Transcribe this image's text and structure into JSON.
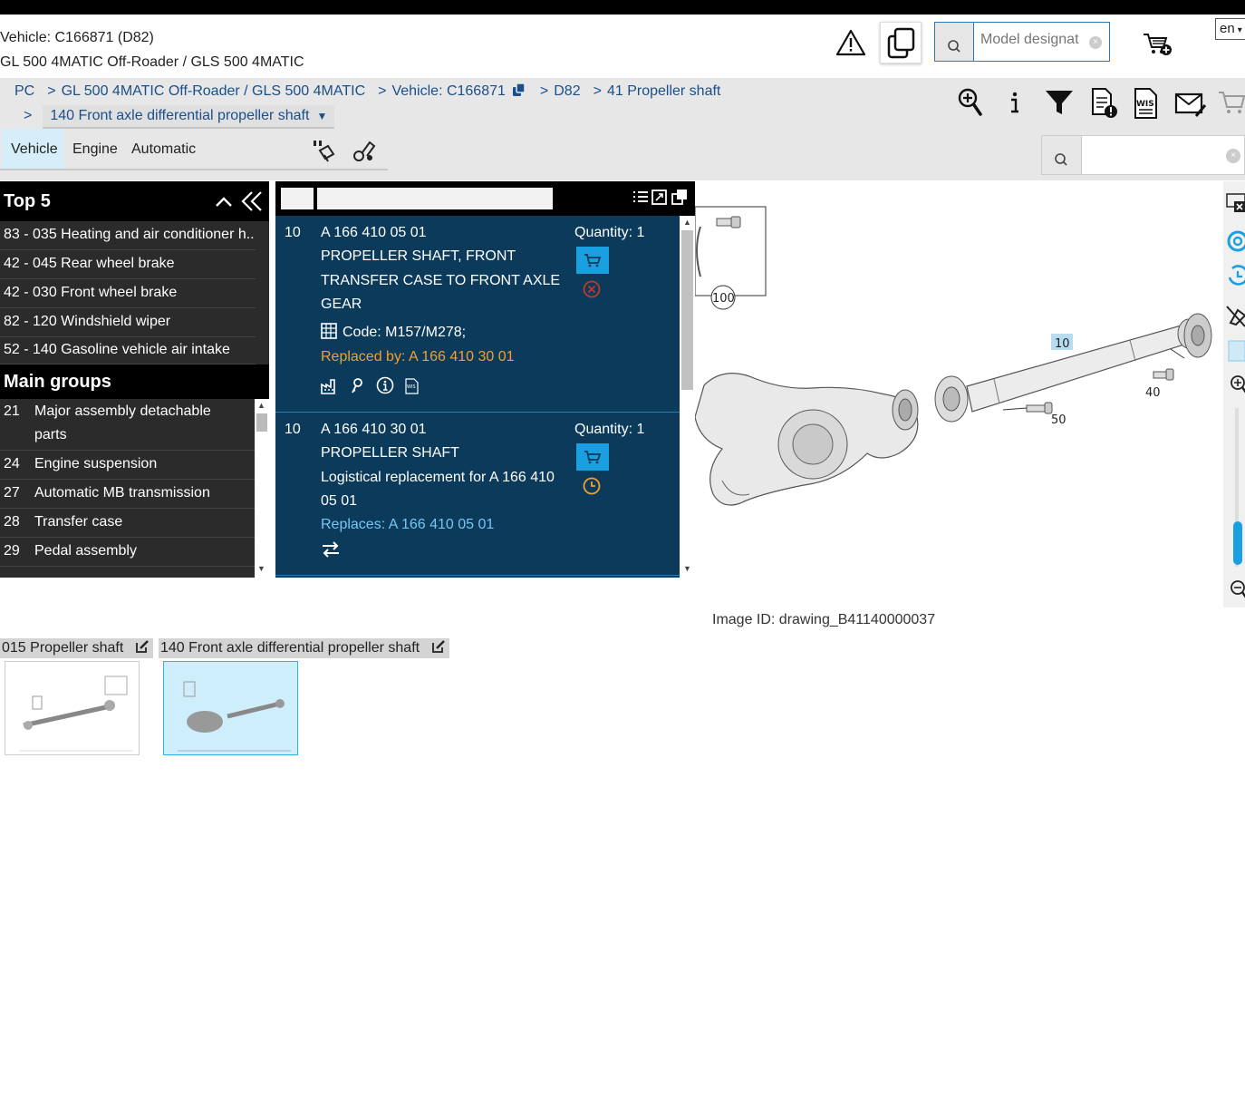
{
  "header": {
    "vehicle_line": "Vehicle: C166871 (D82)",
    "model_line": "GL 500 4MATIC Off-Roader / GLS 500 4MATIC",
    "model_search_placeholder": "Model designat",
    "language": "en"
  },
  "breadcrumb": {
    "items": [
      "PC",
      "GL 500 4MATIC Off-Roader / GLS 500 4MATIC",
      "Vehicle: C166871",
      "D82",
      "41 Propeller shaft"
    ],
    "current": "140 Front axle differential propeller shaft"
  },
  "tabs": [
    "Vehicle",
    "Engine",
    "Automatic transmission"
  ],
  "sidebar": {
    "top5_title": "Top 5",
    "top5": [
      "83 - 035 Heating and air conditioner h...",
      "42 - 045 Rear wheel brake",
      "42 - 030 Front wheel brake",
      "82 - 120 Windshield wiper",
      "52 - 140 Gasoline vehicle air intake"
    ],
    "main_groups_title": "Main groups",
    "main_groups": [
      {
        "num": "21",
        "label": "Major assembly detachable",
        "label2": "parts"
      },
      {
        "num": "24",
        "label": "Engine suspension"
      },
      {
        "num": "27",
        "label": "Automatic MB transmission"
      },
      {
        "num": "28",
        "label": "Transfer case"
      },
      {
        "num": "29",
        "label": "Pedal assembly"
      }
    ]
  },
  "parts": [
    {
      "pos": "10",
      "number": "A 166 410 05 01",
      "desc1": "PROPELLER SHAFT, FRONT",
      "desc2": "TRANSFER CASE TO FRONT AXLE",
      "desc3": "GEAR",
      "code": "Code: M157/M278;",
      "replaced": "Replaced by: A 166 410 30 01",
      "quantity": "Quantity: 1"
    },
    {
      "pos": "10",
      "number": "A 166 410 30 01",
      "desc1": "PROPELLER SHAFT",
      "desc2": "Logistical replacement for A 166 410",
      "desc3": "05 01",
      "replaces": "Replaces: A 166 410 05 01",
      "quantity": "Quantity: 1"
    }
  ],
  "drawing": {
    "callouts": [
      "100",
      "10",
      "40",
      "50"
    ],
    "image_id": "Image ID: drawing_B41140000037"
  },
  "thumbnails": [
    {
      "label": "015 Propeller shaft"
    },
    {
      "label": "140 Front axle differential propeller shaft"
    }
  ],
  "colors": {
    "accent": "#1aa0e0",
    "parts_bg": "#0b3a5a",
    "replaced": "#f2a030",
    "replaces": "#76c8f0"
  }
}
